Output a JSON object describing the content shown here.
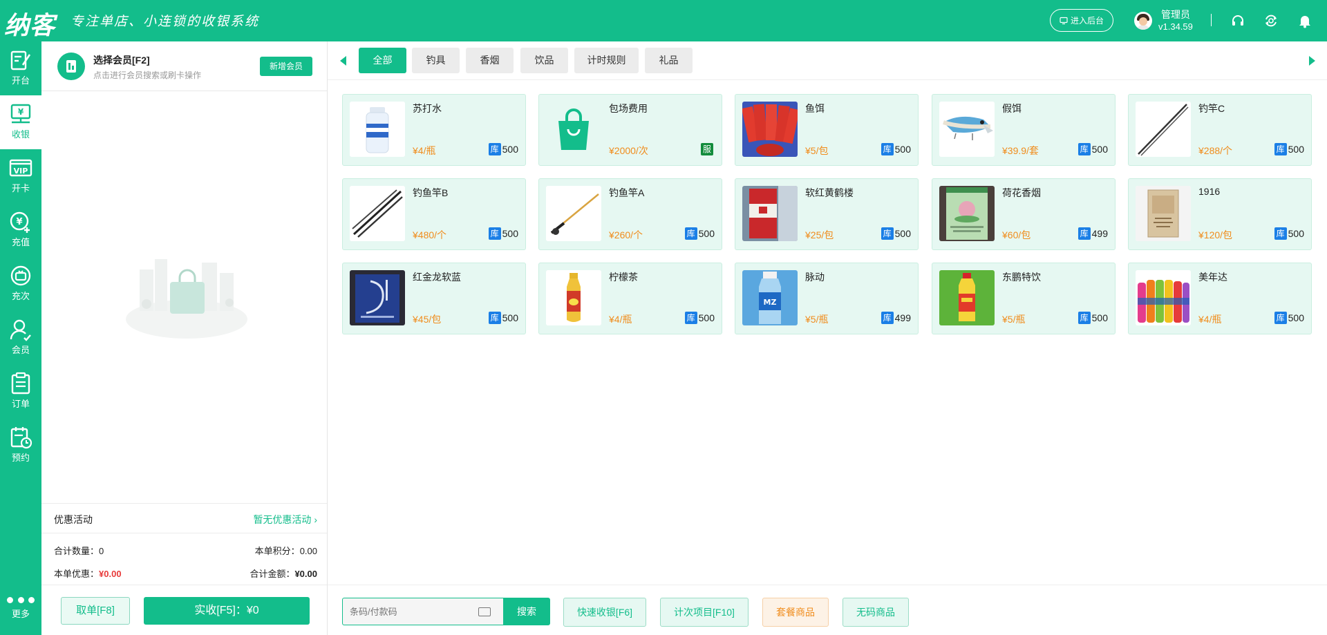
{
  "app": {
    "logo": "纳客",
    "slogan": "专注单店、小连锁的收银系统",
    "admin_button": "进入后台",
    "user_name": "管理员",
    "version": "v1.34.59",
    "brand_color": "#13bd8b"
  },
  "sidebar": {
    "items": [
      {
        "label": "开台",
        "icon": "open-table-icon"
      },
      {
        "label": "收银",
        "icon": "cashier-icon",
        "active": true
      },
      {
        "label": "开卡",
        "icon": "vip-card-icon"
      },
      {
        "label": "充值",
        "icon": "recharge-icon"
      },
      {
        "label": "充次",
        "icon": "recharge-times-icon"
      },
      {
        "label": "会员",
        "icon": "member-icon"
      },
      {
        "label": "订单",
        "icon": "order-icon"
      },
      {
        "label": "预约",
        "icon": "reservation-icon"
      }
    ],
    "more": "更多"
  },
  "member": {
    "title": "选择会员[F2]",
    "subtitle": "点击进行会员搜索或刷卡操作",
    "new_button": "新增会员"
  },
  "promo": {
    "label": "优惠活动",
    "value": "暂无优惠活动"
  },
  "summary": {
    "qty_label": "合计数量：",
    "qty_value": "0",
    "points_label": "本单积分：",
    "points_value": "0.00",
    "discount_label": "本单优惠：",
    "discount_value": "¥0.00",
    "total_label": "合计金额：",
    "total_value": "¥0.00"
  },
  "actions": {
    "cancel": "取单[F8]",
    "pay": "实收[F5]：¥0"
  },
  "categories": [
    {
      "label": "全部",
      "active": true
    },
    {
      "label": "钓具"
    },
    {
      "label": "香烟"
    },
    {
      "label": "饮品"
    },
    {
      "label": "计时规则"
    },
    {
      "label": "礼品"
    }
  ],
  "products": [
    {
      "name": "苏打水",
      "price": "¥4/瓶",
      "tag": "库",
      "stock": "500"
    },
    {
      "name": "包场费用",
      "price": "¥2000/次",
      "tag": "服",
      "stock": ""
    },
    {
      "name": "鱼饵",
      "price": "¥5/包",
      "tag": "库",
      "stock": "500"
    },
    {
      "name": "假饵",
      "price": "¥39.9/套",
      "tag": "库",
      "stock": "500"
    },
    {
      "name": "钓竿C",
      "price": "¥288/个",
      "tag": "库",
      "stock": "500"
    },
    {
      "name": "钓鱼竿B",
      "price": "¥480/个",
      "tag": "库",
      "stock": "500"
    },
    {
      "name": "钓鱼竿A",
      "price": "¥260/个",
      "tag": "库",
      "stock": "500"
    },
    {
      "name": "软红黄鹤楼",
      "price": "¥25/包",
      "tag": "库",
      "stock": "500"
    },
    {
      "name": "荷花香烟",
      "price": "¥60/包",
      "tag": "库",
      "stock": "499"
    },
    {
      "name": "1916",
      "price": "¥120/包",
      "tag": "库",
      "stock": "500"
    },
    {
      "name": "红金龙软蓝",
      "price": "¥45/包",
      "tag": "库",
      "stock": "500"
    },
    {
      "name": "柠檬茶",
      "price": "¥4/瓶",
      "tag": "库",
      "stock": "500"
    },
    {
      "name": "脉动",
      "price": "¥5/瓶",
      "tag": "库",
      "stock": "499"
    },
    {
      "name": "东鹏特饮",
      "price": "¥5/瓶",
      "tag": "库",
      "stock": "500"
    },
    {
      "name": "美年达",
      "price": "¥4/瓶",
      "tag": "库",
      "stock": "500"
    }
  ],
  "bottom": {
    "search_placeholder": "条码/付款码",
    "search_button": "搜索",
    "quick_cash": "快速收银[F6]",
    "count_items": "计次项目[F10]",
    "package": "套餐商品",
    "no_code": "无码商品"
  }
}
